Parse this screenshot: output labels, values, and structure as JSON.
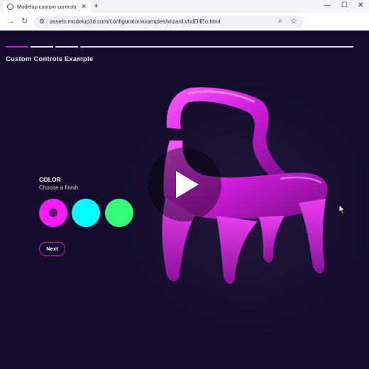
{
  "browser": {
    "tab_title": "Modelup custom controls wizard",
    "new_tab_glyph": "+",
    "close_tab_glyph": "✕",
    "url": "assets.modelup3d.com/configurator/examples/wizard.vhdDlIEo.html",
    "window_controls": {
      "minimize": "—",
      "maximize": "☐",
      "close": "✕"
    },
    "nav": {
      "back": "→",
      "reload": "↻"
    },
    "icons": [
      "favicon-globe-icon",
      "tune-icon",
      "zoom-icon",
      "bookmark-star-icon"
    ]
  },
  "page": {
    "heading": "Custom Controls Example",
    "progress_steps": 4,
    "active_step": 1,
    "step": {
      "title": "COLOR",
      "subtitle": "Choose a finish."
    },
    "swatches": [
      {
        "name": "magenta",
        "color": "#ff19ff",
        "selected": true
      },
      {
        "name": "cyan",
        "color": "#00ffff",
        "selected": false
      },
      {
        "name": "green",
        "color": "#33ff77",
        "selected": false
      }
    ],
    "next_label": "Next",
    "colors": {
      "accent": "#c21ed3",
      "background": "#140c2a",
      "chair": "#d21ee0"
    }
  }
}
